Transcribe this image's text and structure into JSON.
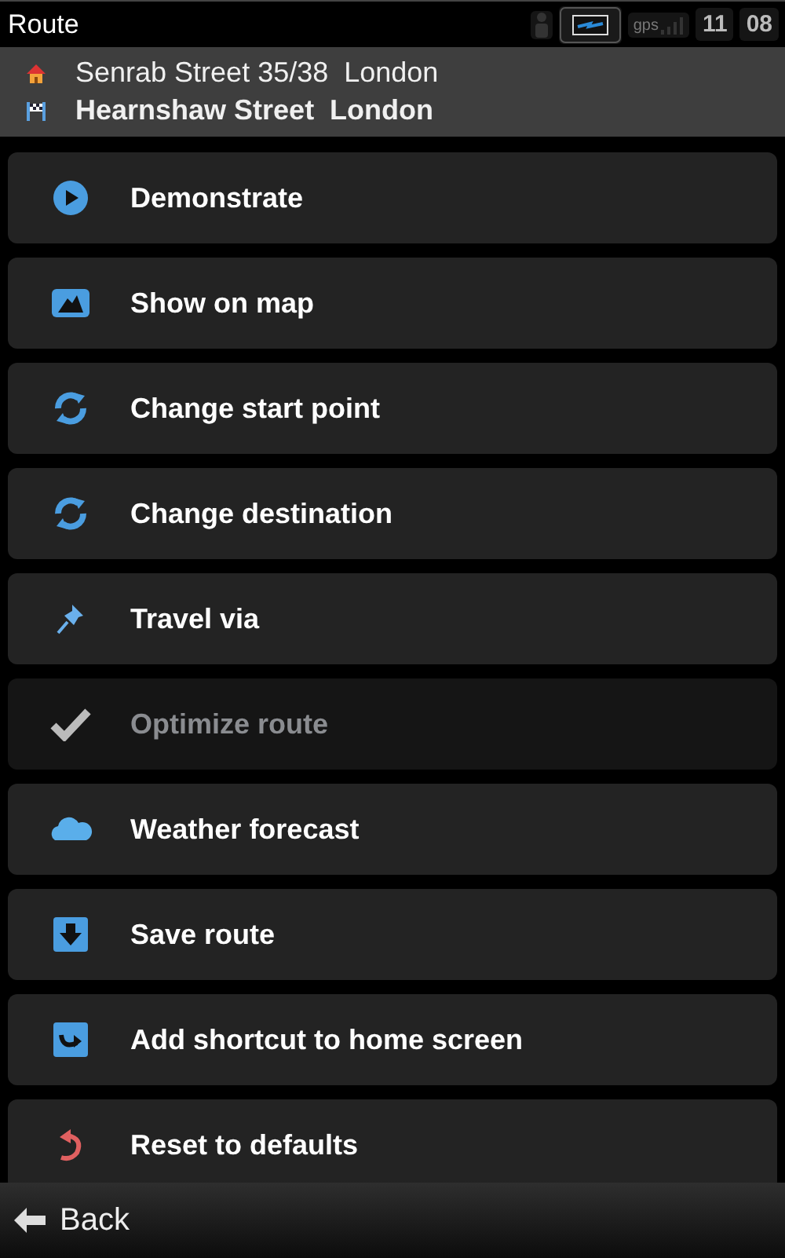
{
  "window": {
    "title": "Route"
  },
  "status": {
    "gps_label": "gps",
    "hour": "11",
    "minute": "08"
  },
  "route": [
    {
      "kind": "home",
      "text": "Senrab Street 35/38  London"
    },
    {
      "kind": "finish",
      "text": "Hearnshaw Street  London"
    }
  ],
  "menu": [
    {
      "kind": "play",
      "label": "Demonstrate",
      "disabled": false
    },
    {
      "kind": "map",
      "label": "Show on map",
      "disabled": false
    },
    {
      "kind": "refresh",
      "label": "Change start point",
      "disabled": false
    },
    {
      "kind": "refresh",
      "label": "Change destination",
      "disabled": false
    },
    {
      "kind": "pin",
      "label": "Travel via",
      "disabled": false
    },
    {
      "kind": "check",
      "label": "Optimize route",
      "disabled": true
    },
    {
      "kind": "cloud",
      "label": "Weather forecast",
      "disabled": false
    },
    {
      "kind": "save",
      "label": "Save route",
      "disabled": false
    },
    {
      "kind": "shortcut",
      "label": "Add shortcut to home screen",
      "disabled": false
    },
    {
      "kind": "reset",
      "label": "Reset to defaults",
      "disabled": false
    }
  ],
  "back": {
    "label": "Back"
  }
}
